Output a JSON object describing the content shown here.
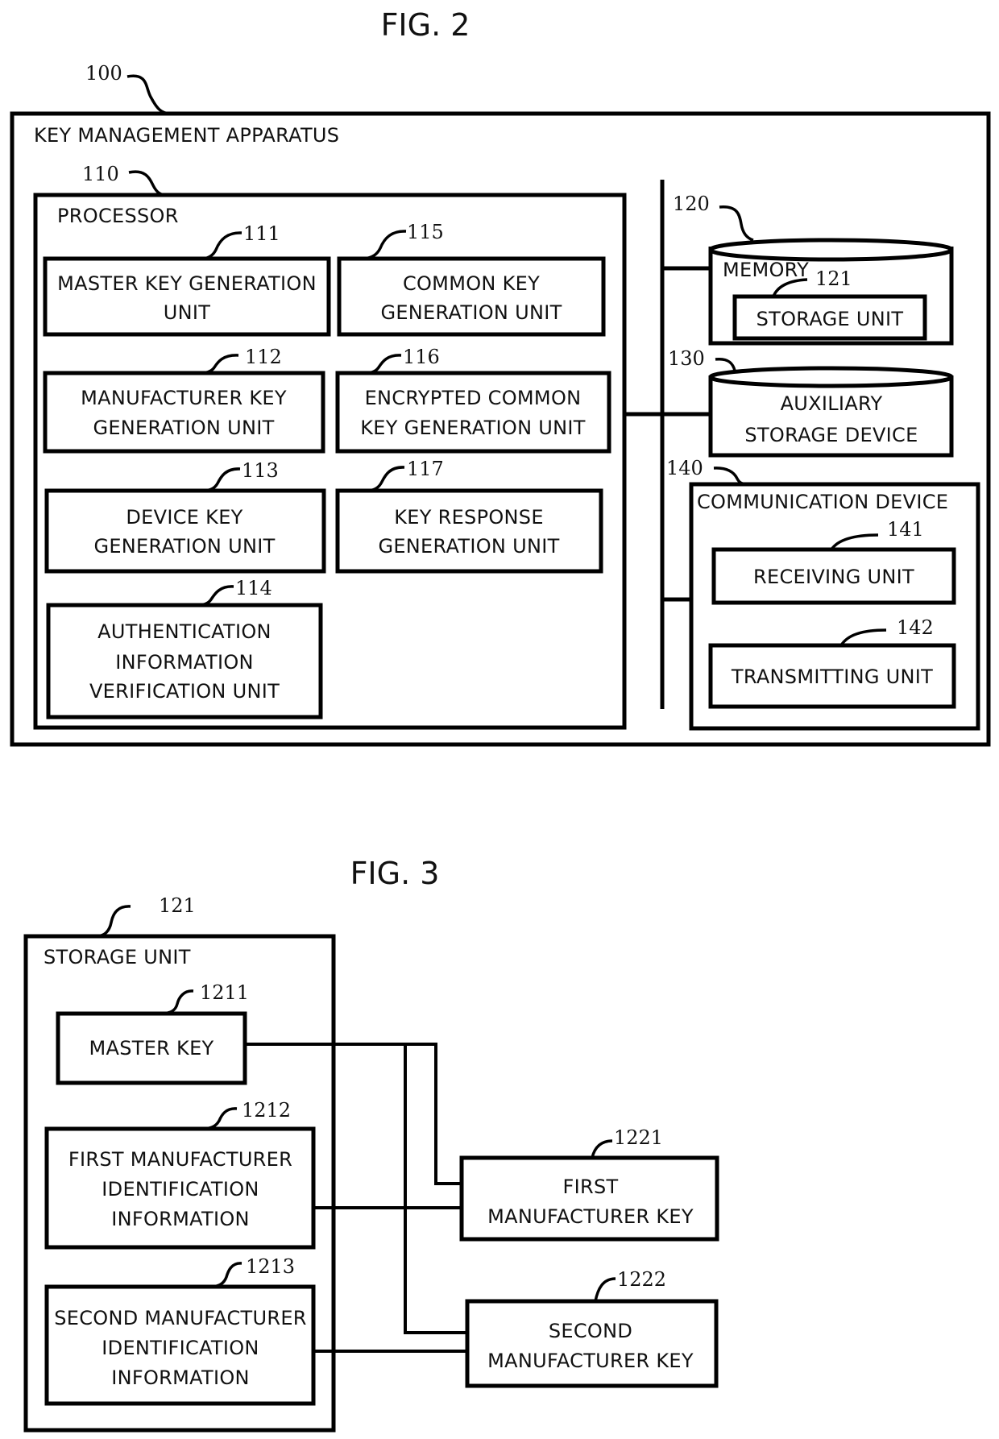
{
  "fig2": {
    "title": "FIG. 2",
    "apparatus": {
      "ref": "100",
      "label": "KEY MANAGEMENT APPARATUS"
    },
    "processor": {
      "ref": "110",
      "label": "PROCESSOR",
      "units": [
        {
          "ref": "111",
          "lines": [
            "MASTER KEY GENERATION",
            "UNIT"
          ]
        },
        {
          "ref": "112",
          "lines": [
            "MANUFACTURER KEY",
            "GENERATION UNIT"
          ]
        },
        {
          "ref": "113",
          "lines": [
            "DEVICE KEY",
            "GENERATION UNIT"
          ]
        },
        {
          "ref": "114",
          "lines": [
            "AUTHENTICATION",
            "INFORMATION",
            "VERIFICATION UNIT"
          ]
        },
        {
          "ref": "115",
          "lines": [
            "COMMON KEY",
            "GENERATION UNIT"
          ]
        },
        {
          "ref": "116",
          "lines": [
            "ENCRYPTED COMMON",
            "KEY GENERATION UNIT"
          ]
        },
        {
          "ref": "117",
          "lines": [
            "KEY RESPONSE",
            "GENERATION UNIT"
          ]
        }
      ]
    },
    "memory": {
      "ref": "120",
      "label": "MEMORY",
      "storage_unit": {
        "ref": "121",
        "label": "STORAGE UNIT"
      }
    },
    "auxiliary": {
      "ref": "130",
      "lines": [
        "AUXILIARY",
        "STORAGE DEVICE"
      ]
    },
    "communication": {
      "ref": "140",
      "label": "COMMUNICATION DEVICE",
      "receiving": {
        "ref": "141",
        "label": "RECEIVING UNIT"
      },
      "transmitting": {
        "ref": "142",
        "label": "TRANSMITTING UNIT"
      }
    }
  },
  "fig3": {
    "title": "FIG. 3",
    "storage_unit": {
      "ref": "121",
      "label": "STORAGE UNIT"
    },
    "items": [
      {
        "ref": "1211",
        "lines": [
          "MASTER KEY"
        ]
      },
      {
        "ref": "1212",
        "lines": [
          "FIRST MANUFACTURER",
          "IDENTIFICATION",
          "INFORMATION"
        ]
      },
      {
        "ref": "1213",
        "lines": [
          "SECOND MANUFACTURER",
          "IDENTIFICATION",
          "INFORMATION"
        ]
      }
    ],
    "keys": [
      {
        "ref": "1221",
        "lines": [
          "FIRST",
          "MANUFACTURER KEY"
        ]
      },
      {
        "ref": "1222",
        "lines": [
          "SECOND",
          "MANUFACTURER KEY"
        ]
      }
    ]
  }
}
